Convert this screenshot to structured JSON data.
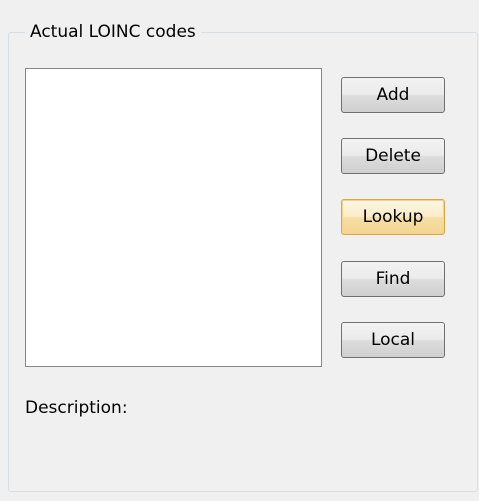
{
  "groupbox": {
    "title": "Actual LOINC codes"
  },
  "listbox": {
    "items": []
  },
  "buttons": {
    "add": "Add",
    "delete": "Delete",
    "lookup": "Lookup",
    "find": "Find",
    "local": "Local"
  },
  "description": {
    "label": "Description:",
    "value": ""
  },
  "colors": {
    "background": "#f0f0f0",
    "focus_border": "#e0a540"
  }
}
